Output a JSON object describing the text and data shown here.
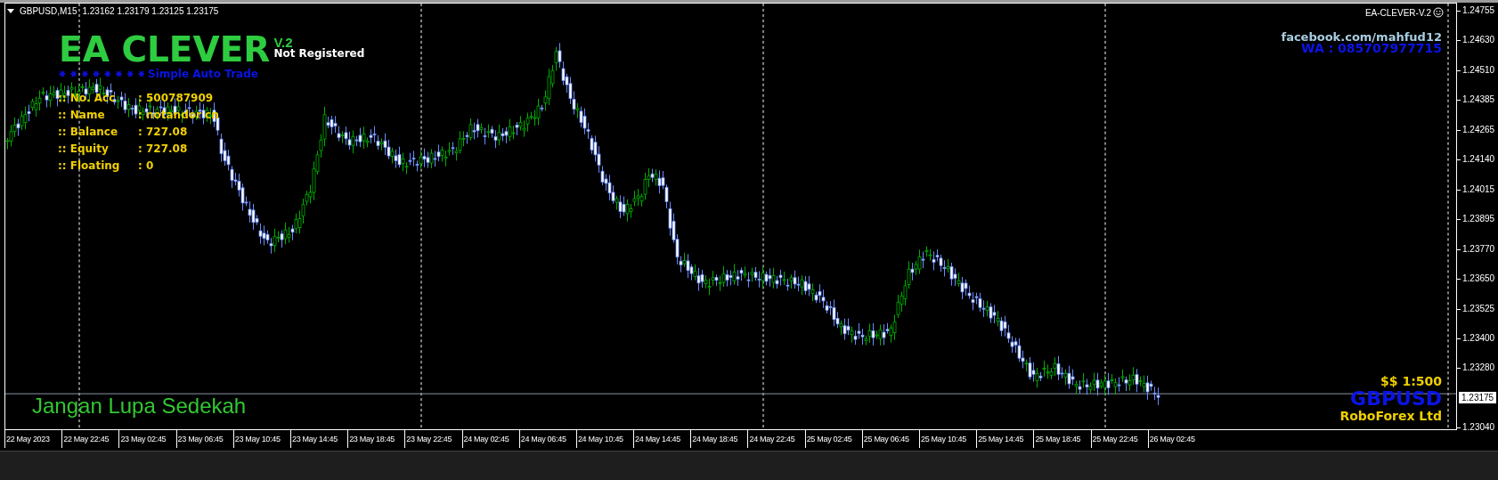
{
  "chart_header": {
    "symbol": "GBPUSD,M15",
    "quotes": "1.23162 1.23179 1.23125 1.23175"
  },
  "expert_label": "EA-CLEVER-V.2",
  "logo": {
    "title": "EA CLEVER",
    "version": "V.2",
    "registration": "Not Registered",
    "tagline": "Simple Auto Trade"
  },
  "account_info": [
    {
      "label": ":: No. Acc",
      "value": ": 500787909"
    },
    {
      "label": ":: Name",
      "value": ": notandor cn"
    },
    {
      "label": ":: Balance",
      "value": ": 727.08"
    },
    {
      "label": ":: Equity",
      "value": ": 727.08"
    },
    {
      "label": ":: Floating",
      "value": ": 0"
    }
  ],
  "contact": {
    "facebook": "facebook.com/mahfud12",
    "whatsapp": "WA : 085707977715"
  },
  "broker_info": {
    "leverage": "$$ 1:500",
    "symbol": "GBPUSD",
    "broker": "RoboForex Ltd"
  },
  "footer_message": "Jangan Lupa Sedekah",
  "price_axis": {
    "labels": [
      "1.24755",
      "1.24630",
      "1.24510",
      "1.24385",
      "1.24265",
      "1.24140",
      "1.24015",
      "1.23895",
      "1.23770",
      "1.23650",
      "1.23525",
      "1.23400",
      "1.23280",
      "1.23040"
    ],
    "current_price": "1.23175"
  },
  "time_axis": {
    "labels": [
      "22 May 2023",
      "22 May 22:45",
      "23 May 02:45",
      "23 May 06:45",
      "23 May 10:45",
      "23 May 14:45",
      "23 May 18:45",
      "23 May 22:45",
      "24 May 02:45",
      "24 May 06:45",
      "24 May 10:45",
      "24 May 14:45",
      "24 May 18:45",
      "24 May 22:45",
      "25 May 02:45",
      "25 May 06:45",
      "25 May 10:45",
      "25 May 14:45",
      "25 May 18:45",
      "25 May 22:45",
      "26 May 02:45"
    ]
  }
}
